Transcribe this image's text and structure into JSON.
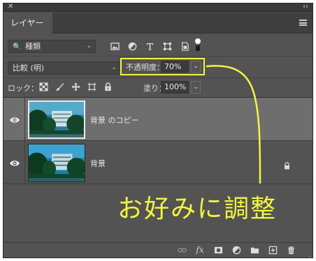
{
  "panel": {
    "tab_label": "レイヤー",
    "close_glyph": "✕",
    "collapse_glyph": "‹‹"
  },
  "filter": {
    "kind_label": "種類",
    "kind_search_glyph": "🔍",
    "icons": [
      "image-filter-icon",
      "adjustment-filter-icon",
      "type-filter-icon",
      "shape-filter-icon",
      "smart-object-filter-icon"
    ],
    "toggle_icon": "filter-toggle-icon"
  },
  "blend": {
    "mode_label": "比較 (明)",
    "opacity_label": "不透明度：",
    "opacity_value": "70%"
  },
  "lock": {
    "label": "ロック：",
    "icons": [
      "lock-transparent-pixels-icon",
      "lock-image-pixels-icon",
      "lock-position-icon",
      "lock-artboard-icon",
      "lock-all-icon"
    ],
    "fill_label": "塗り：",
    "fill_value": "100%"
  },
  "layers": [
    {
      "name": "背景 のコピー",
      "selected": true,
      "locked": false,
      "visible": true
    },
    {
      "name": "背景",
      "selected": false,
      "locked": true,
      "visible": true
    }
  ],
  "annotation": {
    "text": "お好みに調整",
    "color": "#f2f540"
  },
  "bottom_bar": {
    "icons": [
      "link-layers-icon",
      "layer-style-fx-icon",
      "add-mask-icon",
      "new-adjustment-layer-icon",
      "new-group-folder-icon",
      "new-layer-icon",
      "delete-layer-icon"
    ],
    "fx_label": "fx"
  },
  "colors": {
    "panel_bg": "#535353",
    "selected_row": "#6e6e6e",
    "highlight": "#f2f540"
  }
}
